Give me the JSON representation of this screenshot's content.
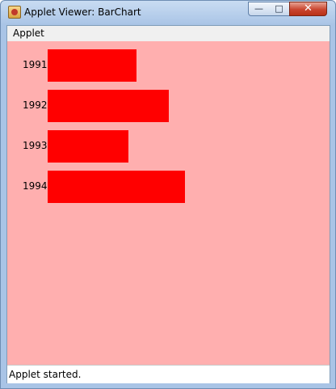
{
  "window": {
    "title": "Applet Viewer: BarChart"
  },
  "menu": {
    "items": [
      "Applet"
    ]
  },
  "chart_data": {
    "type": "bar",
    "orientation": "horizontal",
    "categories": [
      "1991",
      "1992",
      "1993",
      "1994"
    ],
    "values": [
      110,
      150,
      100,
      170
    ],
    "xlim": [
      0,
      350
    ],
    "title": "",
    "xlabel": "",
    "ylabel": "",
    "bar_color": "#ff0000",
    "background": "#ffafaf"
  },
  "status": {
    "text": "Applet started."
  },
  "colors": {
    "bar": "#ff0000",
    "applet_bg": "#ffafaf",
    "close_button": "#c9452f"
  }
}
